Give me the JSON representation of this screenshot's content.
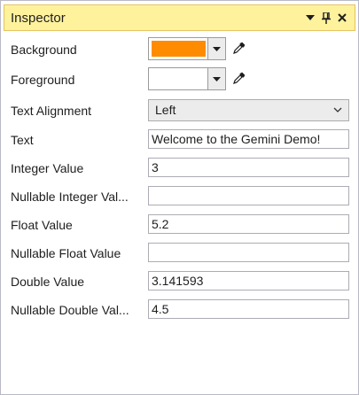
{
  "window": {
    "title": "Inspector"
  },
  "properties": {
    "background": {
      "label": "Background",
      "color": "#ff8c00"
    },
    "foreground": {
      "label": "Foreground",
      "color": "#ffffff"
    },
    "text_alignment": {
      "label": "Text Alignment",
      "value": "Left"
    },
    "text": {
      "label": "Text",
      "value": "Welcome to the Gemini Demo!"
    },
    "integer_value": {
      "label": "Integer Value",
      "value": "3"
    },
    "nullable_integer_value": {
      "label": "Nullable Integer Val...",
      "value": ""
    },
    "float_value": {
      "label": "Float Value",
      "value": "5.2"
    },
    "nullable_float_value": {
      "label": "Nullable Float Value",
      "value": ""
    },
    "double_value": {
      "label": "Double Value",
      "value": "3.141593"
    },
    "nullable_double_value": {
      "label": "Nullable Double Val...",
      "value": "4.5"
    }
  },
  "icons": {
    "dropdown": "triangle-down-icon",
    "pin": "pin-icon",
    "close": "close-icon",
    "eyedropper": "eyedropper-icon",
    "chevron": "chevron-down-icon"
  },
  "colors": {
    "titlebar_bg": "#fff29d",
    "titlebar_border": "#e5c365"
  }
}
